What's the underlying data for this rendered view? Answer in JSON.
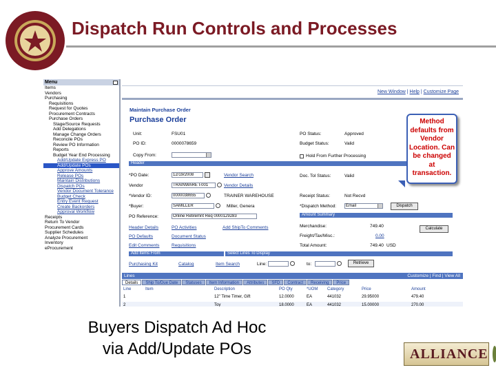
{
  "slide": {
    "title": "Dispatch Run Controls and Processes",
    "caption_line1": "Buyers Dispatch Ad Hoc",
    "caption_line2": "via Add/Update POs",
    "logo_text": "ALLIANCE"
  },
  "callout": {
    "lines": [
      "Method",
      "defaults from",
      "Vendor",
      "Location. Can",
      "be changed",
      "at",
      "transaction."
    ]
  },
  "menu": {
    "title": "Menu",
    "items": [
      {
        "label": "Items",
        "level": 1
      },
      {
        "label": "Vendors",
        "level": 1
      },
      {
        "label": "Purchasing",
        "level": 1
      },
      {
        "label": "Requisitions",
        "level": 2
      },
      {
        "label": "Request for Quotes",
        "level": 2
      },
      {
        "label": "Procurement Contracts",
        "level": 2
      },
      {
        "label": "Purchase Orders",
        "level": 2
      },
      {
        "label": "Stage/Source Requests",
        "level": 3
      },
      {
        "label": "Add Delegations",
        "level": 3
      },
      {
        "label": "Manage Change Orders",
        "level": 3
      },
      {
        "label": "Reconcile POs",
        "level": 3
      },
      {
        "label": "Review PO Information",
        "level": 3
      },
      {
        "label": "Reports",
        "level": 3
      },
      {
        "label": "Budget Year End Processing",
        "level": 3
      },
      {
        "label": "Add/Update Express PO",
        "level": 4
      },
      {
        "label": "Add/Update POs",
        "level": 4,
        "selected": true
      },
      {
        "label": "Approve Amounts",
        "level": 4
      },
      {
        "label": "Release POs",
        "level": 4
      },
      {
        "label": "Maintain Distributions",
        "level": 4
      },
      {
        "label": "Dispatch POs",
        "level": 4
      },
      {
        "label": "Vendor Document Tolerance",
        "level": 4
      },
      {
        "label": "Budget Check",
        "level": 4
      },
      {
        "label": "Entry Event Request",
        "level": 4
      },
      {
        "label": "Create Backorders",
        "level": 4
      },
      {
        "label": "Approval Workflow",
        "level": 4
      },
      {
        "label": "Receipts",
        "level": 1
      },
      {
        "label": "Return To Vendor",
        "level": 1
      },
      {
        "label": "Procurement Cards",
        "level": 1
      },
      {
        "label": "Supplier Schedules",
        "level": 1
      },
      {
        "label": "Analyze Procurement",
        "level": 1
      },
      {
        "label": "Inventory",
        "level": 1
      },
      {
        "label": "eProcurement",
        "level": 1
      }
    ]
  },
  "toplinks": {
    "new_window": "New Window",
    "help": "Help",
    "customize": "Customize Page"
  },
  "component_title": "Maintain Purchase Order",
  "page_title": "Purchase Order",
  "header_fields": {
    "unit_label": "Unit:",
    "unit_value": "FSU01",
    "poid_label": "PO ID:",
    "poid_value": "0000078659",
    "copy_from_label": "Copy From:",
    "po_status_label": "PO Status:",
    "po_status_value": "Approved",
    "budget_status_label": "Budget Status:",
    "budget_status_value": "Valid",
    "hold_label": "Hold From Further Processing",
    "header_section": "Header",
    "po_date_label": "*PO Date:",
    "po_date_value": "12/19/2008",
    "vendor_search": "Vendor Search",
    "vendor_label": "Vendor",
    "vendor_value": "TRAINWARE I-001",
    "vendor_details": "Vendor Details",
    "vendor_id_label": "*Vendor ID:",
    "vendor_id_value": "0000038655",
    "vendor_name": "TRAINER WAREHOUSE",
    "buyer_label": "*Buyer:",
    "buyer_value": "SAMILLER",
    "buyer_name": "Miller, Genera",
    "po_reference_label": "PO Reference:",
    "po_reference_value": "Online Retiremnt Req 0000129283",
    "doc_tol_label": "Doc. Tol Status:",
    "doc_tol_value": "Valid",
    "receipt_status_label": "Receipt Status:",
    "receipt_status_value": "Not Recvd",
    "dispatch_method_label": "*Dispatch Method:",
    "dispatch_method_value": "Email",
    "dispatch_button": "Dispatch"
  },
  "links": {
    "header_details": "Header Details",
    "po_activities": "PO Activities",
    "add_shipto": "Add ShipTo Comments",
    "po_defaults": "PO Defaults",
    "document_status": "Document Status",
    "edit_comments": "Edit Comments",
    "requisitions": "Requisitions"
  },
  "amount_summary": {
    "section": "Amount Summary",
    "merchandise_label": "Merchandise:",
    "merchandise_value": "749.40",
    "freight_label": "Freight/Tax/Misc.:",
    "freight_value": "0.00",
    "total_label": "Total Amount:",
    "total_value": "749.40",
    "currency": "USD",
    "calculate_button": "Calculate"
  },
  "add_items": {
    "section": "Add Items From",
    "purchasing_kit": "Purchasing Kit",
    "catalog": "Catalog",
    "item_search": "Item Search",
    "select_lines": "Select Lines To Display",
    "line_label": "Line:",
    "to_label": "to:",
    "retrieve_button": "Retrieve"
  },
  "lines": {
    "title": "Lines",
    "right": "Customize | Find | View All",
    "tabs": [
      "Details",
      "Ship To/Due Date",
      "Statuses",
      "Item Information",
      "Attributes",
      "SFD",
      "Contract",
      "Receiving",
      "Price"
    ],
    "cols": [
      "Line",
      "Item",
      "Description",
      "PO Qty",
      "*UOM",
      "Category",
      "Price",
      "Amount"
    ],
    "rows": [
      {
        "line": "1",
        "description": "12\" Time Timer, Gift",
        "qty": "12.0000",
        "uom": "EA",
        "category": "441032",
        "price": "29.95000",
        "amount": "479.40"
      },
      {
        "line": "2",
        "description": "Toy",
        "qty": "18.0000",
        "uom": "EA",
        "category": "441032",
        "price": "15.00000",
        "amount": "270.00"
      }
    ]
  }
}
